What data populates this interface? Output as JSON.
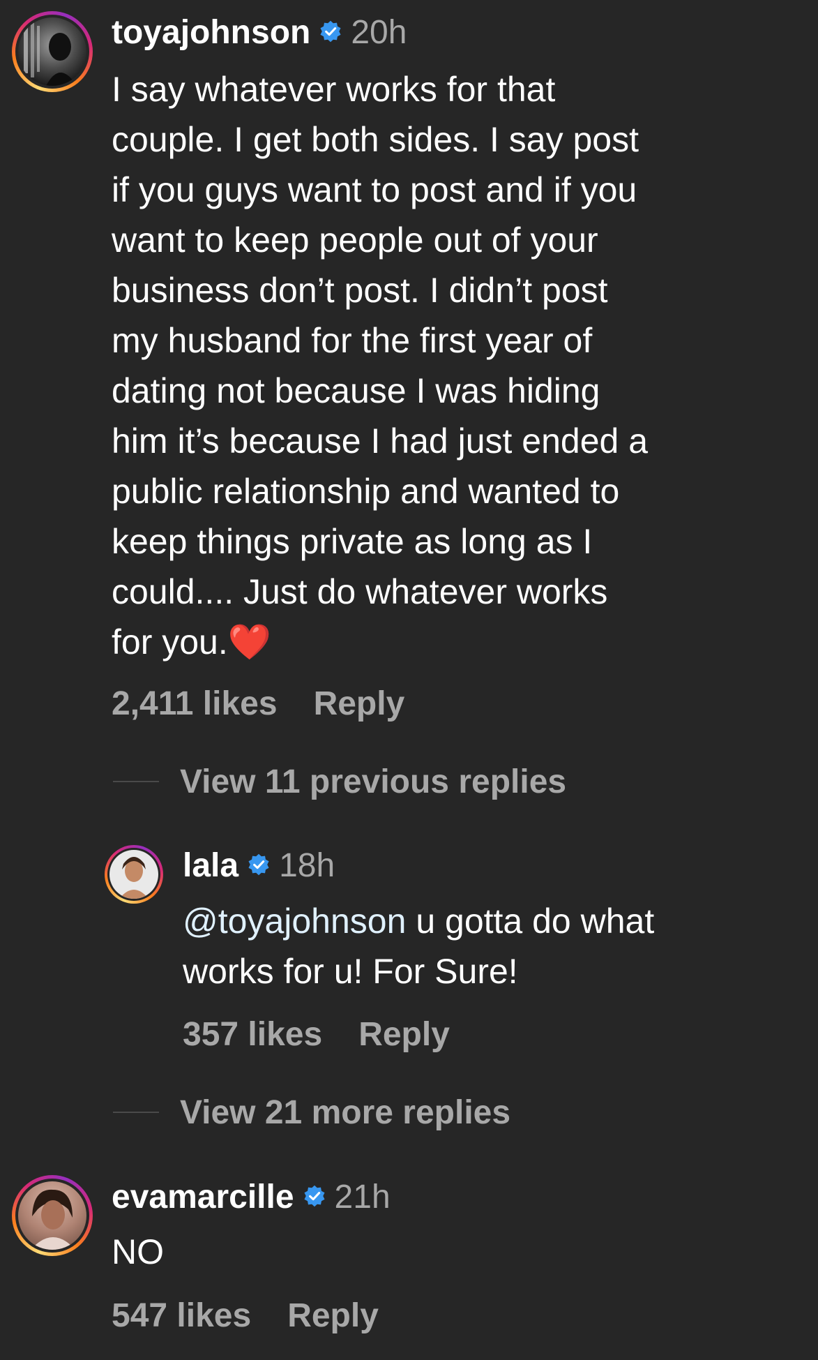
{
  "comments": [
    {
      "username": "toyajohnson",
      "time": "20h",
      "text": "I say whatever works for that\ncouple.  I get both sides.  I say post\nif you guys want to post and if you\nwant to keep people out of your\nbusiness don’t post.  I didn’t post\nmy husband for the first year of\ndating not because I was hiding\nhim it’s because I had just ended a\npublic relationship and wanted to\nkeep things private as long as I\ncould.... Just do whatever works\nfor you.❤️",
      "likes": "2,411 likes",
      "reply_label": "Reply",
      "view_replies_label": "View 11 previous replies"
    },
    {
      "username": "lala",
      "time": "18h",
      "mention": "@toyajohnson",
      "text": " u gotta do what\nworks for u! For Sure!",
      "likes": "357 likes",
      "reply_label": "Reply",
      "view_replies_label": "View 21 more replies"
    },
    {
      "username": "evamarcille",
      "time": "21h",
      "text": "NO",
      "likes": "547 likes",
      "reply_label": "Reply"
    }
  ],
  "colors": {
    "background": "#262626",
    "verified_badge": "#3897f0",
    "secondary_text": "#a8a8a8",
    "mention": "#e0f1ff"
  }
}
